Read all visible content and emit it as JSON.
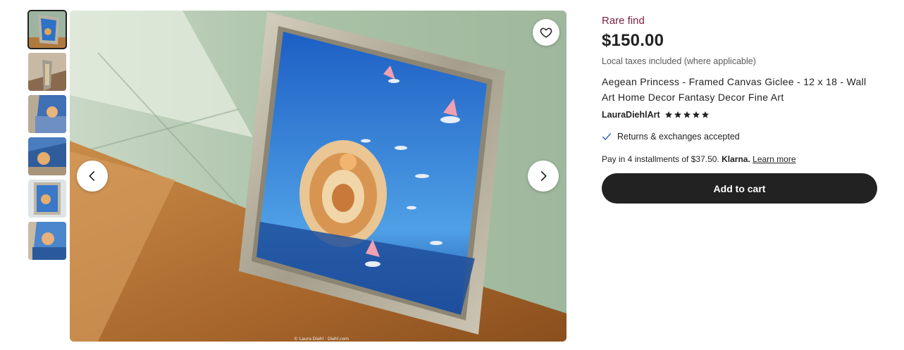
{
  "gallery": {
    "thumbnails": [
      {
        "name": "thumb-1",
        "active": true
      },
      {
        "name": "thumb-2",
        "active": false
      },
      {
        "name": "thumb-3",
        "active": false
      },
      {
        "name": "thumb-4",
        "active": false
      },
      {
        "name": "thumb-5",
        "active": false
      },
      {
        "name": "thumb-6",
        "active": false
      }
    ],
    "favorite_icon": "heart-outline-icon",
    "prev_icon": "chevron-left-icon",
    "next_icon": "chevron-right-icon",
    "watermark": "© Laura Diehl · Diehl.com"
  },
  "listing": {
    "badge": "Rare find",
    "price": "$150.00",
    "tax_note": "Local taxes included (where applicable)",
    "title": "Aegean Princess - Framed Canvas Giclee - 12 x 18 - Wall Art Home Decor Fantasy Decor Fine Art",
    "seller": "LauraDiehlArt",
    "rating_stars": 5,
    "returns": "Returns & exchanges accepted",
    "klarna": {
      "prefix": "Pay in 4 installments of $37.50. ",
      "brand": "Klarna.",
      "link": "Learn more"
    },
    "cart_button": "Add to cart"
  },
  "colors": {
    "badge": "#7d1f3e",
    "button": "#222222",
    "check": "#2b5cb8"
  }
}
